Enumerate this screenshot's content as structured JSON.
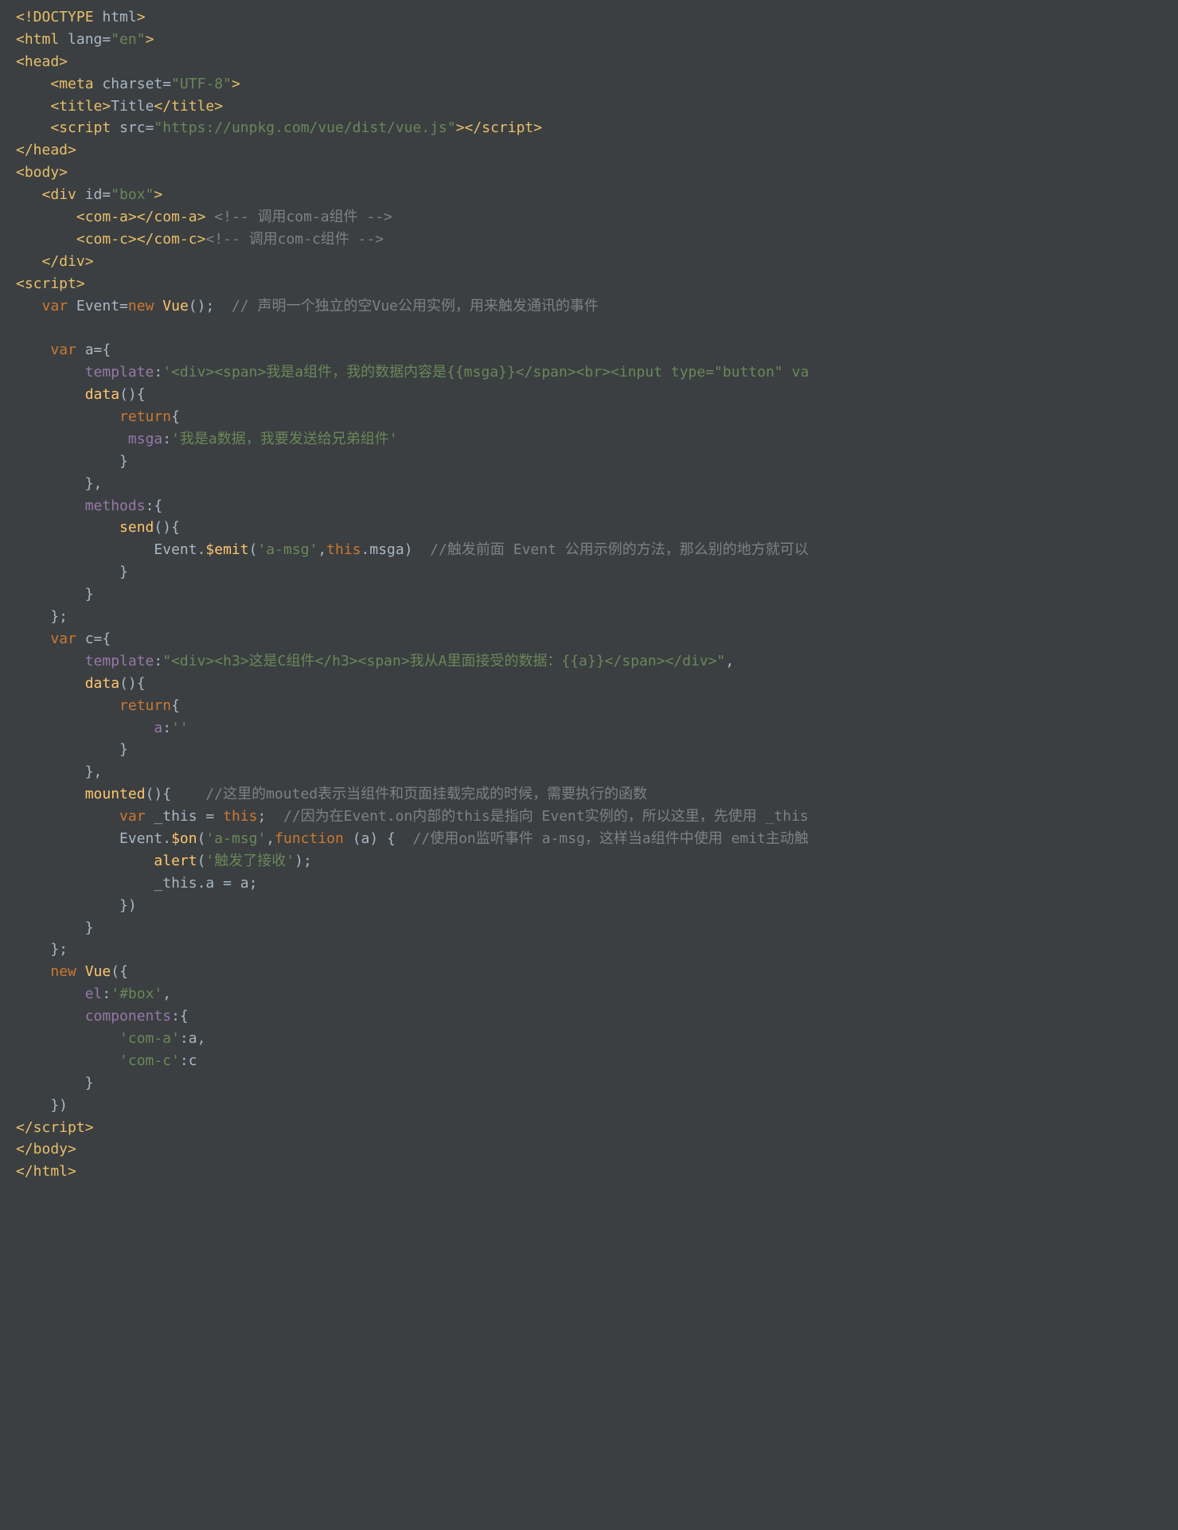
{
  "lines": [
    [
      [
        "tag",
        "<!DOCTYPE "
      ],
      [
        "attr",
        "html"
      ],
      [
        "tag",
        ">"
      ]
    ],
    [
      [
        "tag",
        "<html "
      ],
      [
        "attr",
        "lang="
      ],
      [
        "str",
        "\"en\""
      ],
      [
        "tag",
        ">"
      ]
    ],
    [
      [
        "tag",
        "<head>"
      ]
    ],
    [
      [
        "id",
        "    "
      ],
      [
        "tag",
        "<meta "
      ],
      [
        "attr",
        "charset="
      ],
      [
        "str",
        "\"UTF-8\""
      ],
      [
        "tag",
        ">"
      ]
    ],
    [
      [
        "id",
        "    "
      ],
      [
        "tag",
        "<title>"
      ],
      [
        "id",
        "Title"
      ],
      [
        "tag",
        "</title>"
      ]
    ],
    [
      [
        "id",
        "    "
      ],
      [
        "tag",
        "<script "
      ],
      [
        "attr",
        "src="
      ],
      [
        "str",
        "\"https://unpkg.com/vue/dist/vue.js\""
      ],
      [
        "tag",
        "></script>"
      ]
    ],
    [
      [
        "tag",
        "</head>"
      ]
    ],
    [
      [
        "tag",
        "<body>"
      ]
    ],
    [
      [
        "id",
        "   "
      ],
      [
        "tag",
        "<div "
      ],
      [
        "attr",
        "id="
      ],
      [
        "str",
        "\"box\""
      ],
      [
        "tag",
        ">"
      ]
    ],
    [
      [
        "id",
        "       "
      ],
      [
        "tag",
        "<com-a></com-a>"
      ],
      [
        "id",
        " "
      ],
      [
        "cmt",
        "<!-- 调用com-a组件 -->"
      ]
    ],
    [
      [
        "id",
        "       "
      ],
      [
        "tag",
        "<com-c></com-c>"
      ],
      [
        "cmt",
        "<!-- 调用com-c组件 -->"
      ]
    ],
    [
      [
        "id",
        "   "
      ],
      [
        "tag",
        "</div>"
      ]
    ],
    [
      [
        "tag",
        "<script>"
      ]
    ],
    [
      [
        "id",
        "   "
      ],
      [
        "kw",
        "var "
      ],
      [
        "id",
        "Event="
      ],
      [
        "kw",
        "new "
      ],
      [
        "fn",
        "Vue"
      ],
      [
        "id",
        "();  "
      ],
      [
        "cmt",
        "// 声明一个独立的空Vue公用实例，用来触发通讯的事件"
      ]
    ],
    [
      [
        "id",
        " "
      ]
    ],
    [
      [
        "id",
        "    "
      ],
      [
        "kw",
        "var "
      ],
      [
        "id",
        "a={"
      ]
    ],
    [
      [
        "id",
        "        "
      ],
      [
        "prop",
        "template"
      ],
      [
        "id",
        ":"
      ],
      [
        "str",
        "'<div><span>我是a组件，我的数据内容是{{msga}}</span><br><input type=\"button\" va"
      ]
    ],
    [
      [
        "id",
        "        "
      ],
      [
        "fn",
        "data"
      ],
      [
        "id",
        "(){"
      ]
    ],
    [
      [
        "id",
        "            "
      ],
      [
        "kw",
        "return"
      ],
      [
        "id",
        "{"
      ]
    ],
    [
      [
        "id",
        "             "
      ],
      [
        "prop",
        "msga"
      ],
      [
        "id",
        ":"
      ],
      [
        "str",
        "'我是a数据，我要发送给兄弟组件'"
      ]
    ],
    [
      [
        "id",
        "            }"
      ]
    ],
    [
      [
        "id",
        "        },"
      ]
    ],
    [
      [
        "id",
        "        "
      ],
      [
        "prop",
        "methods"
      ],
      [
        "id",
        ":{"
      ]
    ],
    [
      [
        "id",
        "            "
      ],
      [
        "fn",
        "send"
      ],
      [
        "id",
        "(){"
      ]
    ],
    [
      [
        "id",
        "                Event."
      ],
      [
        "fn",
        "$emit"
      ],
      [
        "id",
        "("
      ],
      [
        "str",
        "'a-msg'"
      ],
      [
        "id",
        ","
      ],
      [
        "kw",
        "this"
      ],
      [
        "id",
        ".msga)  "
      ],
      [
        "cmt",
        "//触发前面 Event 公用示例的方法，那么别的地方就可以"
      ]
    ],
    [
      [
        "id",
        "            }"
      ]
    ],
    [
      [
        "id",
        "        }"
      ]
    ],
    [
      [
        "id",
        "    };"
      ]
    ],
    [
      [
        "id",
        "    "
      ],
      [
        "kw",
        "var "
      ],
      [
        "id",
        "c={"
      ]
    ],
    [
      [
        "id",
        "        "
      ],
      [
        "prop",
        "template"
      ],
      [
        "id",
        ":"
      ],
      [
        "str",
        "\"<div><h3>这是C组件</h3><span>我从A里面接受的数据：{{a}}</span></div>\""
      ],
      [
        "id",
        ","
      ]
    ],
    [
      [
        "id",
        "        "
      ],
      [
        "fn",
        "data"
      ],
      [
        "id",
        "(){"
      ]
    ],
    [
      [
        "id",
        "            "
      ],
      [
        "kw",
        "return"
      ],
      [
        "id",
        "{"
      ]
    ],
    [
      [
        "id",
        "                "
      ],
      [
        "prop",
        "a"
      ],
      [
        "id",
        ":"
      ],
      [
        "str",
        "''"
      ]
    ],
    [
      [
        "id",
        "            }"
      ]
    ],
    [
      [
        "id",
        "        },"
      ]
    ],
    [
      [
        "id",
        "        "
      ],
      [
        "fn",
        "mounted"
      ],
      [
        "id",
        "(){    "
      ],
      [
        "cmt",
        "//这里的mouted表示当组件和页面挂载完成的时候，需要执行的函数"
      ]
    ],
    [
      [
        "id",
        "            "
      ],
      [
        "kw",
        "var "
      ],
      [
        "id",
        "_this = "
      ],
      [
        "kw",
        "this"
      ],
      [
        "id",
        ";  "
      ],
      [
        "cmt",
        "//因为在Event.on内部的this是指向 Event实例的，所以这里，先使用 _this"
      ]
    ],
    [
      [
        "id",
        "            Event."
      ],
      [
        "fn",
        "$on"
      ],
      [
        "id",
        "("
      ],
      [
        "str",
        "'a-msg'"
      ],
      [
        "id",
        ","
      ],
      [
        "kw",
        "function "
      ],
      [
        "id",
        "(a) {  "
      ],
      [
        "cmt",
        "//使用on监听事件 a-msg，这样当a组件中使用 emit主动触"
      ]
    ],
    [
      [
        "id",
        "                "
      ],
      [
        "fn",
        "alert"
      ],
      [
        "id",
        "("
      ],
      [
        "str",
        "'触发了接收'"
      ],
      [
        "id",
        ");"
      ]
    ],
    [
      [
        "id",
        "                _this.a = a;"
      ]
    ],
    [
      [
        "id",
        "            })"
      ]
    ],
    [
      [
        "id",
        "        }"
      ]
    ],
    [
      [
        "id",
        "    };"
      ]
    ],
    [
      [
        "id",
        "    "
      ],
      [
        "kw",
        "new "
      ],
      [
        "fn",
        "Vue"
      ],
      [
        "id",
        "({"
      ]
    ],
    [
      [
        "id",
        "        "
      ],
      [
        "prop",
        "el"
      ],
      [
        "id",
        ":"
      ],
      [
        "str",
        "'#box'"
      ],
      [
        "id",
        ","
      ]
    ],
    [
      [
        "id",
        "        "
      ],
      [
        "prop",
        "components"
      ],
      [
        "id",
        ":{"
      ]
    ],
    [
      [
        "id",
        "            "
      ],
      [
        "str",
        "'com-a'"
      ],
      [
        "id",
        ":a,"
      ]
    ],
    [
      [
        "id",
        "            "
      ],
      [
        "str",
        "'com-c'"
      ],
      [
        "id",
        ":c"
      ]
    ],
    [
      [
        "id",
        "        }"
      ]
    ],
    [
      [
        "id",
        "    })"
      ]
    ],
    [
      [
        "tag",
        "</script>"
      ]
    ],
    [
      [
        "tag",
        "</body>"
      ]
    ],
    [
      [
        "tag",
        "</html>"
      ]
    ]
  ]
}
